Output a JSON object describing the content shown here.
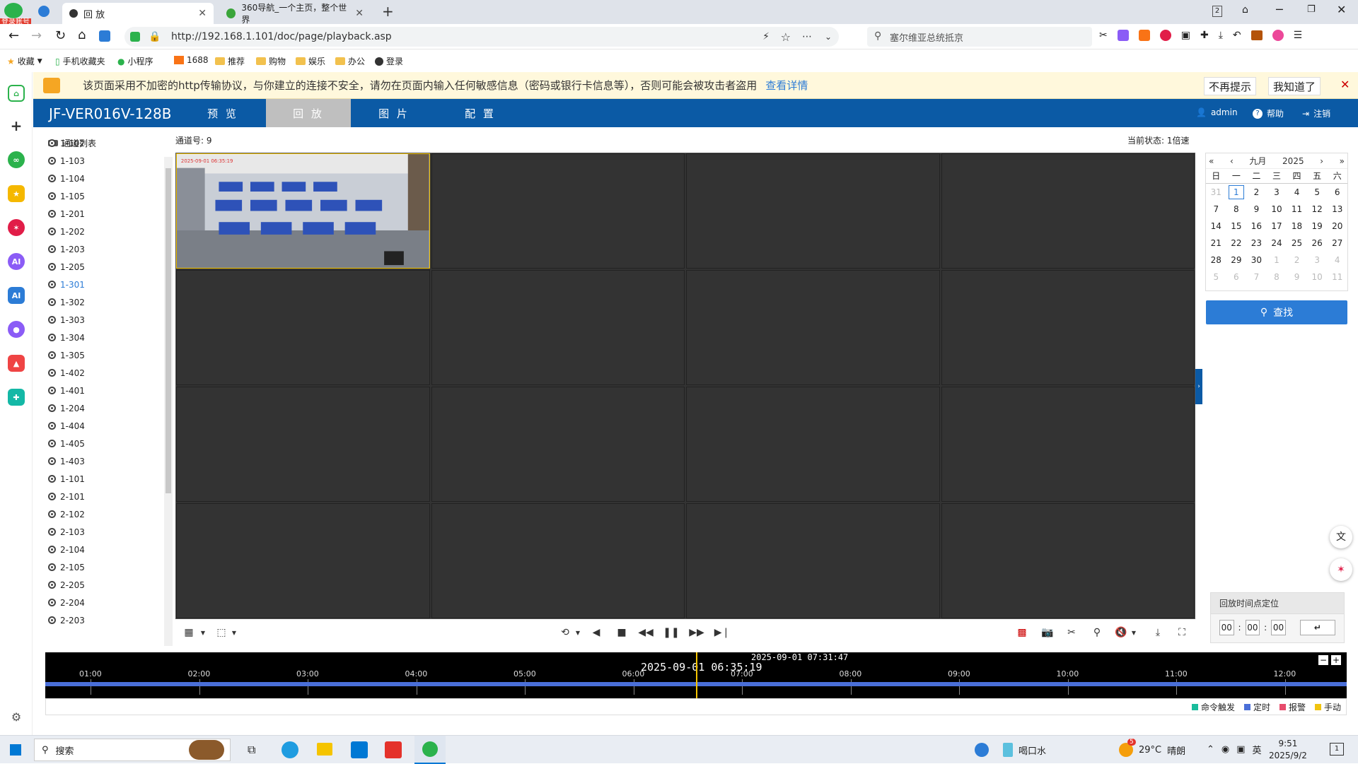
{
  "browser": {
    "login_badge": "登录账号",
    "tabs": [
      {
        "label": "回 放",
        "active": true
      },
      {
        "label": "360导航_一个主页，整个世界",
        "active": false
      }
    ],
    "url": "http://192.168.1.101/doc/page/playback.asp",
    "search_text": "塞尔维亚总统抵京",
    "tab_count": "2"
  },
  "bookmarks": [
    "收藏",
    "手机收藏夹",
    "小程序",
    "1688",
    "推荐",
    "购物",
    "娱乐",
    "办公",
    "登录"
  ],
  "warning": {
    "text": "该页面采用不加密的http传输协议，与你建立的连接不安全，请勿在页面内输入任何敏感信息（密码或银行卡信息等），否则可能会被攻击者盗用",
    "link": "查看详情",
    "btn_noshow": "不再提示",
    "btn_know": "我知道了"
  },
  "app": {
    "title": "JF-VER016V-128B",
    "nav": [
      "预 览",
      "回 放",
      "图 片",
      "配 置"
    ],
    "user": "admin",
    "help": "帮助",
    "logout": "注销"
  },
  "channels": {
    "header": "通道列表",
    "items": [
      "1-102",
      "1-103",
      "1-104",
      "1-105",
      "1-201",
      "1-202",
      "1-203",
      "1-205",
      "1-301",
      "1-302",
      "1-303",
      "1-304",
      "1-305",
      "1-402",
      "1-401",
      "1-204",
      "1-404",
      "1-405",
      "1-403",
      "1-101",
      "2-101",
      "2-102",
      "2-103",
      "2-104",
      "2-105",
      "2-205",
      "2-204",
      "2-203"
    ],
    "active_index": 8
  },
  "status": {
    "channel_no": "通道号: 9",
    "current_state": "当前状态: 1倍速"
  },
  "calendar": {
    "month": "九月",
    "year": "2025",
    "weekdays": [
      "日",
      "一",
      "二",
      "三",
      "四",
      "五",
      "六"
    ],
    "days": [
      "31",
      "1",
      "2",
      "3",
      "4",
      "5",
      "6",
      "7",
      "8",
      "9",
      "10",
      "11",
      "12",
      "13",
      "14",
      "15",
      "16",
      "17",
      "18",
      "19",
      "20",
      "21",
      "22",
      "23",
      "24",
      "25",
      "26",
      "27",
      "28",
      "29",
      "30",
      "1",
      "2",
      "3",
      "4",
      "5",
      "6",
      "7",
      "8",
      "9",
      "10",
      "11"
    ],
    "today_index": 1,
    "search": "查找"
  },
  "timepos": {
    "title": "回放时间点定位",
    "hh": "00",
    "mm": "00",
    "ss": "00"
  },
  "timeline": {
    "current": "2025-09-01 06:35:19",
    "hover": "2025-09-01 07:31:47",
    "ticks": [
      "01:00",
      "02:00",
      "03:00",
      "04:00",
      "05:00",
      "06:00",
      "07:00",
      "08:00",
      "09:00",
      "10:00",
      "11:00",
      "12:00"
    ],
    "legend": [
      {
        "label": "命令触发",
        "color": "#1abc9c"
      },
      {
        "label": "定时",
        "color": "#4a6fd8"
      },
      {
        "label": "报警",
        "color": "#e74c6c"
      },
      {
        "label": "手动",
        "color": "#f1c40f"
      }
    ]
  },
  "taskbar": {
    "search": "搜索",
    "weather_app": "喝口水",
    "temp": "29°C",
    "weather": "晴朗",
    "ime": "英",
    "time": "9:51",
    "date": "2025/9/2",
    "badge": "5",
    "notif": "1"
  },
  "colors": {
    "accent": "#0b5aa5",
    "button": "#2c7cd6",
    "selected_cell": "#f5c400"
  }
}
